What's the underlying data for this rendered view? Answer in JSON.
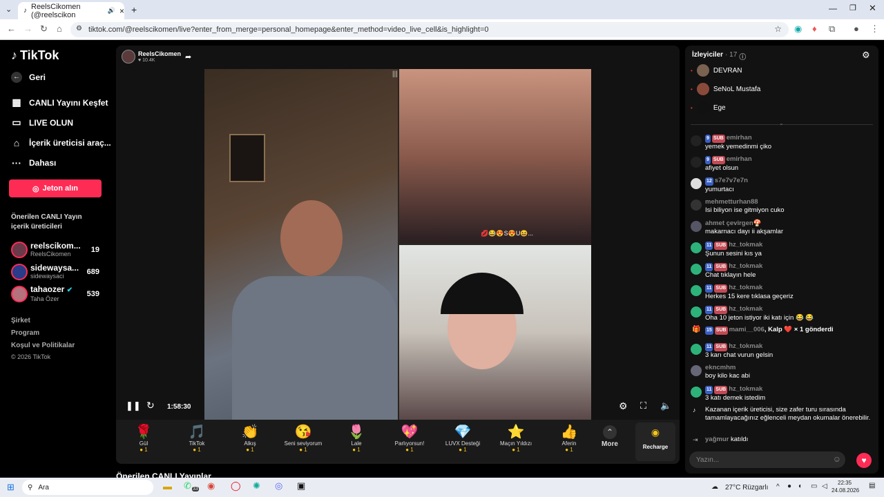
{
  "browser": {
    "tab_title": "ReelsCikomen (@reelscikon",
    "url": "tiktok.com/@reelscikomen/live?enter_from_merge=personal_homepage&enter_method=video_live_cell&is_highlight=0"
  },
  "sidebar": {
    "logo": "TikTok",
    "back": "Geri",
    "nav": [
      {
        "label": "CANLI Yayını Keşfet",
        "icon": "live-explore-icon"
      },
      {
        "label": "LIVE OLUN",
        "icon": "camera-icon"
      },
      {
        "label": "İçerik üreticisi araç...",
        "icon": "home-icon"
      },
      {
        "label": "Dahası",
        "icon": "more-icon"
      }
    ],
    "coins_button": "Jeton alın",
    "suggested_title": "Önerilen CANLI Yayın içerik üreticileri",
    "creators": [
      {
        "name": "reelscikom...",
        "sub": "ReelsCikomen",
        "count": "19"
      },
      {
        "name": "sidewaysa...",
        "sub": "sidewaysaci",
        "count": "689"
      },
      {
        "name": "tahaozer",
        "sub": "Taha Özer",
        "count": "539"
      }
    ],
    "footer": [
      "Şirket",
      "Program",
      "Koşul ve Politikalar",
      "© 2026 TikTok"
    ]
  },
  "stream": {
    "host": "ReelsCikomen",
    "likes": "10.4K",
    "time": "1:58:30",
    "overlay_emojis": "💋😂😍S😍U😆..."
  },
  "gifts": [
    {
      "name": "Gül",
      "icon": "🌹",
      "cost": "1"
    },
    {
      "name": "TikTok",
      "icon": "🎵",
      "cost": "1"
    },
    {
      "name": "Alkış",
      "icon": "👏",
      "cost": "1"
    },
    {
      "name": "Seni seviyorum",
      "icon": "😘",
      "cost": "1"
    },
    {
      "name": "Lale",
      "icon": "🌷",
      "cost": "1"
    },
    {
      "name": "Parlıyorsun!",
      "icon": "💖",
      "cost": "1"
    },
    {
      "name": "LUVX Desteği",
      "icon": "💎",
      "cost": "1"
    },
    {
      "name": "Maçın Yıldızı",
      "icon": "⭐",
      "cost": "1"
    },
    {
      "name": "Aferin",
      "icon": "👍",
      "cost": "1"
    }
  ],
  "gift_more": "More",
  "recharge": "Recharge",
  "panel": {
    "viewers_title": "İzleyiciler",
    "viewers_count": "· 17",
    "viewers": [
      "DEVRAN",
      "SeNoL Mustafa",
      "Ege"
    ],
    "messages": [
      {
        "user": "emirhan",
        "badges": [
          "9",
          "SUB"
        ],
        "text": "yemek yemedinmi çiko",
        "avatar": "#222"
      },
      {
        "user": "emirhan",
        "badges": [
          "9",
          "SUB"
        ],
        "text": "afiyet olsun",
        "avatar": "#222"
      },
      {
        "user": "s7e7v7e7n",
        "badges": [
          "12"
        ],
        "text": "yumurtacı",
        "avatar": "#ddd"
      },
      {
        "user": "mehmetturhan88",
        "badges": [],
        "text": "Isi biliyon ise gitmiyon cuko",
        "avatar": "#333"
      },
      {
        "user": "ahmet çevirgen🍄",
        "badges": [],
        "text": "makarnacı dayı ii akşamlar",
        "avatar": "#556"
      },
      {
        "user": "hz_tokmak",
        "badges": [
          "11",
          "SUB"
        ],
        "text": "Şunun sesini kıs ya",
        "avatar": "#2db37a"
      },
      {
        "user": "hz_tokmak",
        "badges": [
          "11",
          "SUB"
        ],
        "text": "Chat tıklayın hele",
        "avatar": "#2db37a"
      },
      {
        "user": "hz_tokmak",
        "badges": [
          "11",
          "SUB"
        ],
        "text": "Herkes 15 kere tıklasa geçeriz",
        "avatar": "#2db37a"
      },
      {
        "user": "hz_tokmak",
        "badges": [
          "11",
          "SUB"
        ],
        "text": "Oha 10 jeton istiyor iki katı için 😂 😂",
        "avatar": "#2db37a"
      }
    ],
    "gift_msg": {
      "user": "mami__006",
      "badge": "15",
      "text": ", Kalp ❤️ × 1 gönderdi"
    },
    "messages2": [
      {
        "user": "hz_tokmak",
        "badges": [
          "11",
          "SUB"
        ],
        "text": "3 karı chat vurun gelsin",
        "avatar": "#2db37a"
      },
      {
        "user": "ekncmhm",
        "badges": [],
        "text": "boy kilo kac abi",
        "avatar": "#667"
      },
      {
        "user": "hz_tokmak",
        "badges": [
          "11",
          "SUB"
        ],
        "text": "3 katı demek istedim",
        "avatar": "#2db37a"
      }
    ],
    "system_msg": "Kazanan içerik üreticisi, size zafer turu sırasında tamamlayacağınız eğlenceli meydan okumalar önerebilir.",
    "join_msg": {
      "user": "yağmur",
      "text": "katıldı"
    },
    "chat_placeholder": "Yazın..."
  },
  "taskbar": {
    "search": "Ara",
    "weather": "27°C  Rüzgarlı",
    "time": "22:35",
    "date": "24.08.2026",
    "badge": "33"
  },
  "below": "Önerilen CANLI Yayınlar"
}
